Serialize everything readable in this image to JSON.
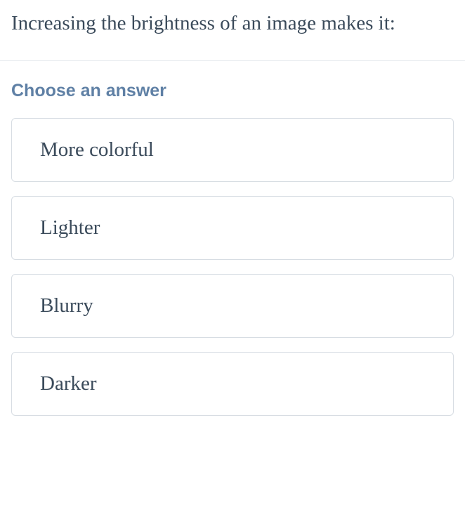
{
  "question": "Increasing the brightness of an image makes it:",
  "choose_label": "Choose an answer",
  "options": [
    {
      "label": "More colorful"
    },
    {
      "label": "Lighter"
    },
    {
      "label": "Blurry"
    },
    {
      "label": "Darker"
    }
  ]
}
